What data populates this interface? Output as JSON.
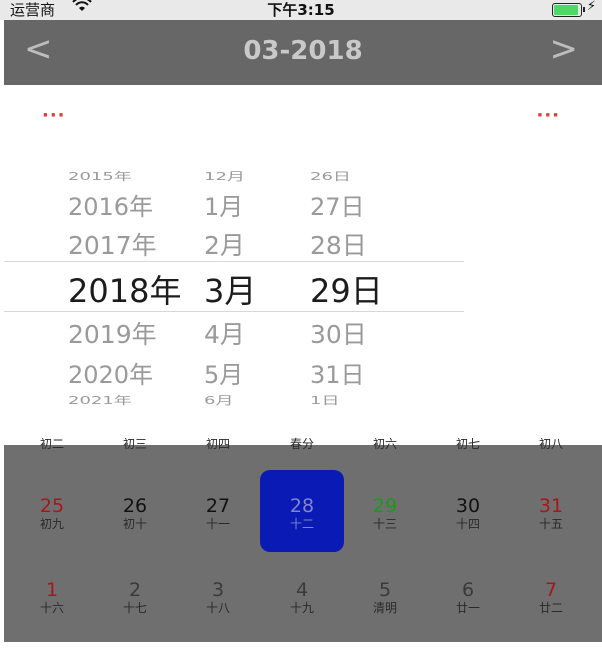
{
  "status_bar": {
    "carrier": "运营商",
    "time": "下午3:15"
  },
  "header": {
    "title": "03-2018",
    "prev": "<",
    "next": ">"
  },
  "sheet": {
    "left_action": "···",
    "right_action": "···"
  },
  "picker": {
    "years": [
      "2015年",
      "2016年",
      "2017年",
      "2018年",
      "2019年",
      "2020年",
      "2021年"
    ],
    "months": [
      "12月",
      "1月",
      "2月",
      "3月",
      "4月",
      "5月",
      "6月"
    ],
    "days": [
      "26日",
      "27日",
      "28日",
      "29日",
      "30日",
      "31日",
      "1日"
    ],
    "selected_index": 3
  },
  "calendar": {
    "partial_row": [
      "初二",
      "初三",
      "初四",
      "春分",
      "初六",
      "初七",
      "初八"
    ],
    "row1": [
      {
        "num": "25",
        "lunar": "初九"
      },
      {
        "num": "26",
        "lunar": "初十"
      },
      {
        "num": "27",
        "lunar": "十一"
      },
      {
        "num": "28",
        "lunar": "十二"
      },
      {
        "num": "29",
        "lunar": "十三"
      },
      {
        "num": "30",
        "lunar": "十四"
      },
      {
        "num": "31",
        "lunar": "十五"
      }
    ],
    "row2": [
      {
        "num": "1",
        "lunar": "十六"
      },
      {
        "num": "2",
        "lunar": "十七"
      },
      {
        "num": "3",
        "lunar": "十八"
      },
      {
        "num": "4",
        "lunar": "十九"
      },
      {
        "num": "5",
        "lunar": "清明"
      },
      {
        "num": "6",
        "lunar": "廿一"
      },
      {
        "num": "7",
        "lunar": "廿二"
      }
    ],
    "selected_day": "28",
    "selected_color": "#0a1ab4"
  }
}
